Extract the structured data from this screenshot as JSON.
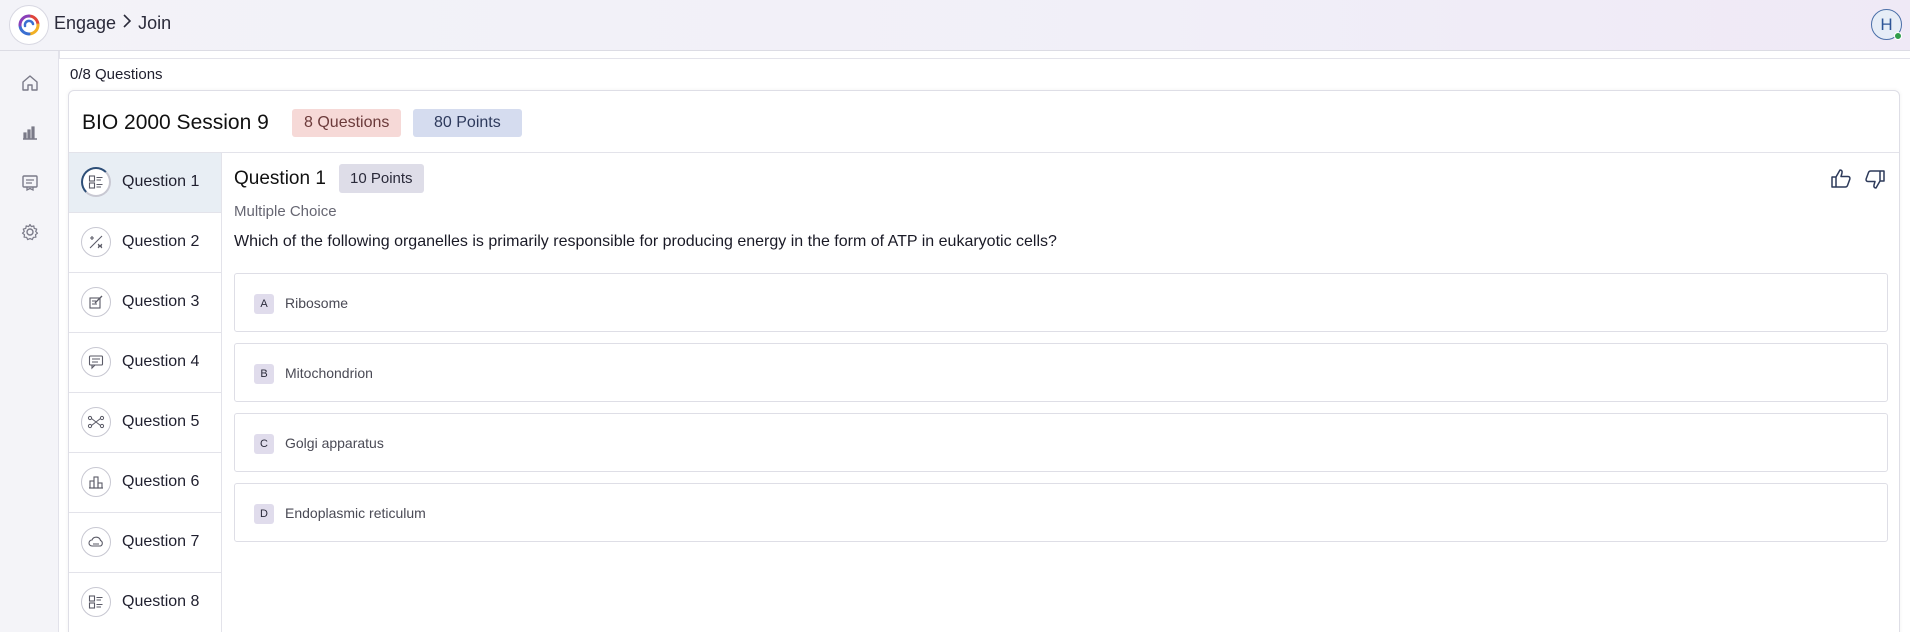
{
  "header": {
    "breadcrumb": [
      "Engage",
      "Join"
    ],
    "avatar_initial": "H"
  },
  "sidebar": {
    "icons": [
      "home-icon",
      "chart-icon",
      "book-icon",
      "gear-icon"
    ]
  },
  "progress": {
    "label": "0/8 Questions",
    "answered": 0,
    "total": 8
  },
  "session": {
    "title": "BIO 2000 Session 9",
    "questions_badge": "8 Questions",
    "points_badge": "80 Points"
  },
  "question_list": [
    {
      "label": "Question 1",
      "icon": "list-check-icon",
      "active": true
    },
    {
      "label": "Question 2",
      "icon": "fraction-icon",
      "active": false
    },
    {
      "label": "Question 3",
      "icon": "edit-icon",
      "active": false
    },
    {
      "label": "Question 4",
      "icon": "chat-icon",
      "active": false
    },
    {
      "label": "Question 5",
      "icon": "connect-icon",
      "active": false
    },
    {
      "label": "Question 6",
      "icon": "buildings-icon",
      "active": false
    },
    {
      "label": "Question 7",
      "icon": "cloud-icon",
      "active": false
    },
    {
      "label": "Question 8",
      "icon": "list-check-icon",
      "active": false
    }
  ],
  "question": {
    "title": "Question 1",
    "points": "10 Points",
    "type": "Multiple Choice",
    "text": "Which of the following organelles is primarily responsible for producing energy in the form of ATP in eukaryotic cells?",
    "options": [
      {
        "letter": "A",
        "text": "Ribosome"
      },
      {
        "letter": "B",
        "text": "Mitochondrion"
      },
      {
        "letter": "C",
        "text": "Golgi apparatus"
      },
      {
        "letter": "D",
        "text": "Endoplasmic reticulum"
      }
    ]
  },
  "colors": {
    "accent": "#2d4e77",
    "questions_badge_bg": "#f6d9d7",
    "points_badge_bg": "#d5dcef",
    "active_item_bg": "#e8eef4",
    "online_status": "#2f9d4a"
  }
}
